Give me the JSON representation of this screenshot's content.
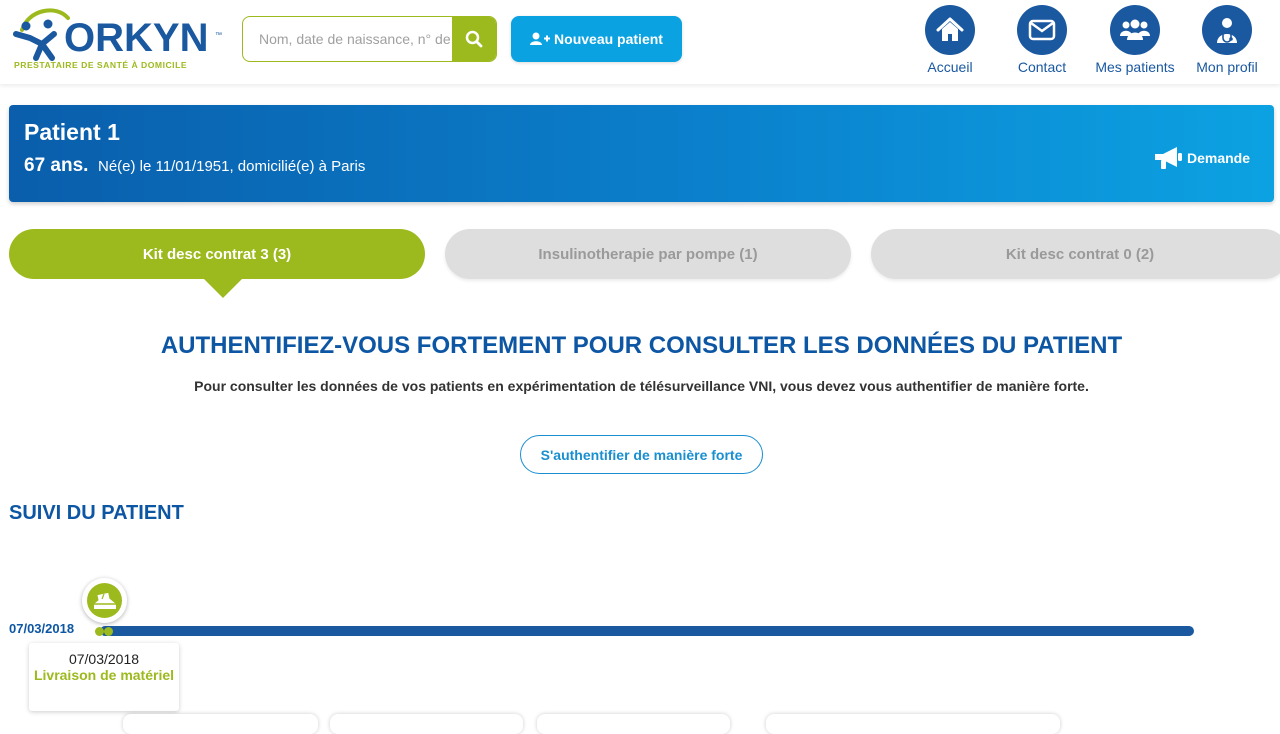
{
  "header": {
    "logo": {
      "wordmark": "ORKYN",
      "trademark": "™",
      "tagline": "PRESTATAIRE DE SANTÉ À DOMICILE"
    },
    "search": {
      "placeholder": "Nom, date de naissance, n° de dossier",
      "value": "",
      "icon": "search-icon"
    },
    "new_patient_label": "Nouveau patient",
    "nav": [
      {
        "label": "Accueil",
        "icon": "home-icon"
      },
      {
        "label": "Contact",
        "icon": "envelope-icon"
      },
      {
        "label": "Mes patients",
        "icon": "users-icon"
      },
      {
        "label": "Mon profil",
        "icon": "doctor-icon"
      }
    ]
  },
  "patient": {
    "name": "Patient 1",
    "age": "67 ans.",
    "info": "Né(e) le 11/01/1951, domicilié(e) à Paris",
    "request_label": "Demande",
    "request_icon": "megaphone-icon"
  },
  "tabs": [
    {
      "label": "Kit desc contrat 3 (3)",
      "active": true
    },
    {
      "label": "Insulinotherapie par pompe (1)",
      "active": false
    },
    {
      "label": "Kit desc contrat 0 (2)",
      "active": false
    }
  ],
  "auth": {
    "title": "AUTHENTIFIEZ-VOUS FORTEMENT POUR CONSULTER LES DONNÉES DU PATIENT",
    "text": "Pour consulter les données de vos patients en expérimentation de télésurveillance VNI, vous devez vous authentifier de manière forte.",
    "button_label": "S'authentifier de manière forte"
  },
  "followup": {
    "title": "SUIVI DU PATIENT",
    "start_date": "07/03/2018",
    "event": {
      "date": "07/03/2018",
      "label": "Livraison de matériel",
      "icon": "delivery-icon"
    }
  },
  "colors": {
    "primary": "#1a58a0",
    "accent": "#9cba1e",
    "cyan": "#0aa2e0"
  }
}
